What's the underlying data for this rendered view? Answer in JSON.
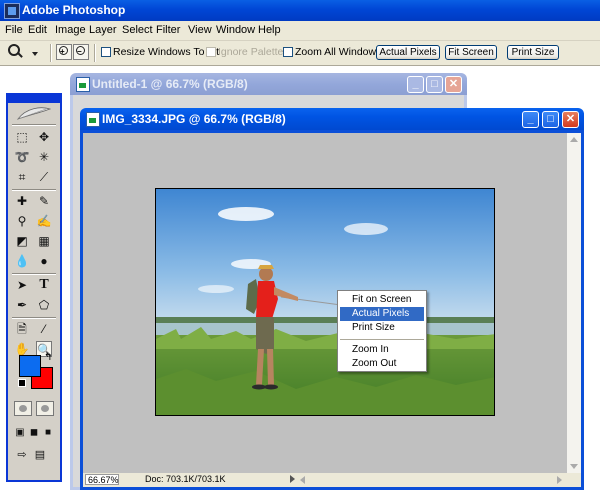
{
  "app": {
    "title": "Adobe Photoshop"
  },
  "menu": [
    "File",
    "Edit",
    "Image",
    "Layer",
    "Select",
    "Filter",
    "View",
    "Window",
    "Help"
  ],
  "options": {
    "resize_windows": "Resize Windows To Fit",
    "ignore_palettes": "Ignore Palettes",
    "zoom_all": "Zoom All Windows",
    "actual_pixels": "Actual Pixels",
    "fit_screen": "Fit Screen",
    "print_size": "Print Size"
  },
  "toolbox": {
    "foreground_color": "#0c6cf0",
    "background_color": "#ff0000"
  },
  "windows": {
    "untitled": {
      "title": "Untitled-1 @ 66.7% (RGB/8)"
    },
    "image": {
      "title": "IMG_3334.JPG @ 66.7% (RGB/8)",
      "zoom": "66.67%",
      "doc": "Doc: 703.1K/703.1K"
    }
  },
  "context_menu": {
    "items": [
      "Fit on Screen",
      "Actual Pixels",
      "Print Size",
      "Zoom In",
      "Zoom Out"
    ],
    "highlighted": "Actual Pixels"
  }
}
